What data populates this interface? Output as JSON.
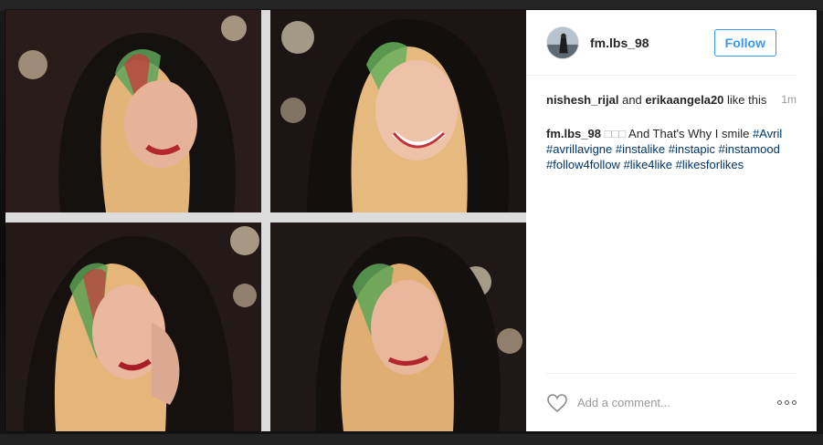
{
  "post": {
    "username": "fm.lbs_98",
    "follow_label": "Follow",
    "likes": {
      "user1": "nishesh_rijal",
      "connector": " and ",
      "user2": "erikaangela20",
      "suffix": " like this"
    },
    "time": "1m",
    "caption": {
      "username": "fm.lbs_98",
      "symbols": " □□□",
      "text": " And That's Why I smile ",
      "hashtags": [
        "#Avril",
        "#avrillavigne",
        "#instalike",
        "#instapic",
        "#instamood",
        "#follow4follow",
        "#like4like",
        "#likesforlikes"
      ]
    },
    "comment_placeholder": "Add a comment..."
  },
  "icons": {
    "like": "heart-outline-icon",
    "more": "more-options-icon",
    "avatar": "user-avatar"
  },
  "colors": {
    "accent": "#3897f0",
    "hashtag": "#003569",
    "muted": "#999999",
    "divider": "#efefef"
  }
}
